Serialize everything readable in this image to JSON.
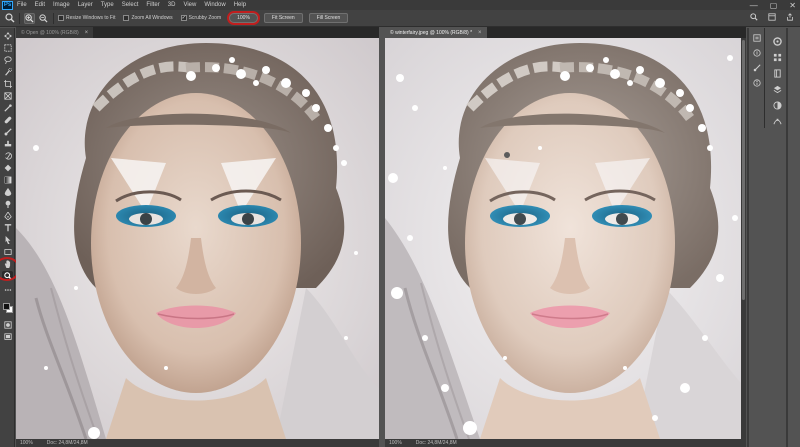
{
  "app": {
    "logo_text": "Ps"
  },
  "menu": [
    "File",
    "Edit",
    "Image",
    "Layer",
    "Type",
    "Select",
    "Filter",
    "3D",
    "View",
    "Window",
    "Help"
  ],
  "window_controls": {
    "minimize": "—",
    "maximize": "▢",
    "close": "✕"
  },
  "options": {
    "resize_windows_label": "Resize Windows to Fit",
    "zoom_all_windows_label": "Zoom All Windows",
    "scrubby_zoom_label": "Scrubby Zoom",
    "scrubby_zoom_checked": "✓",
    "zoom_value": "100%",
    "fit_screen_label": "Fit Screen",
    "fill_screen_label": "Fill Screen"
  },
  "documents": [
    {
      "tab_label": "© Open @ 100% (RGB/8)",
      "status_zoom": "100%",
      "status_doc": "Doc: 24,8M/24,8M"
    },
    {
      "tab_label": "© winterfairy.jpeg @ 100% (RGB/8) *",
      "status_zoom": "100%",
      "status_doc": "Doc: 24,8M/24,8M"
    }
  ],
  "colors": {
    "accent_highlight": "#c01e1e",
    "ps_blue": "#31a8ff",
    "ui_dark": "#424242"
  }
}
